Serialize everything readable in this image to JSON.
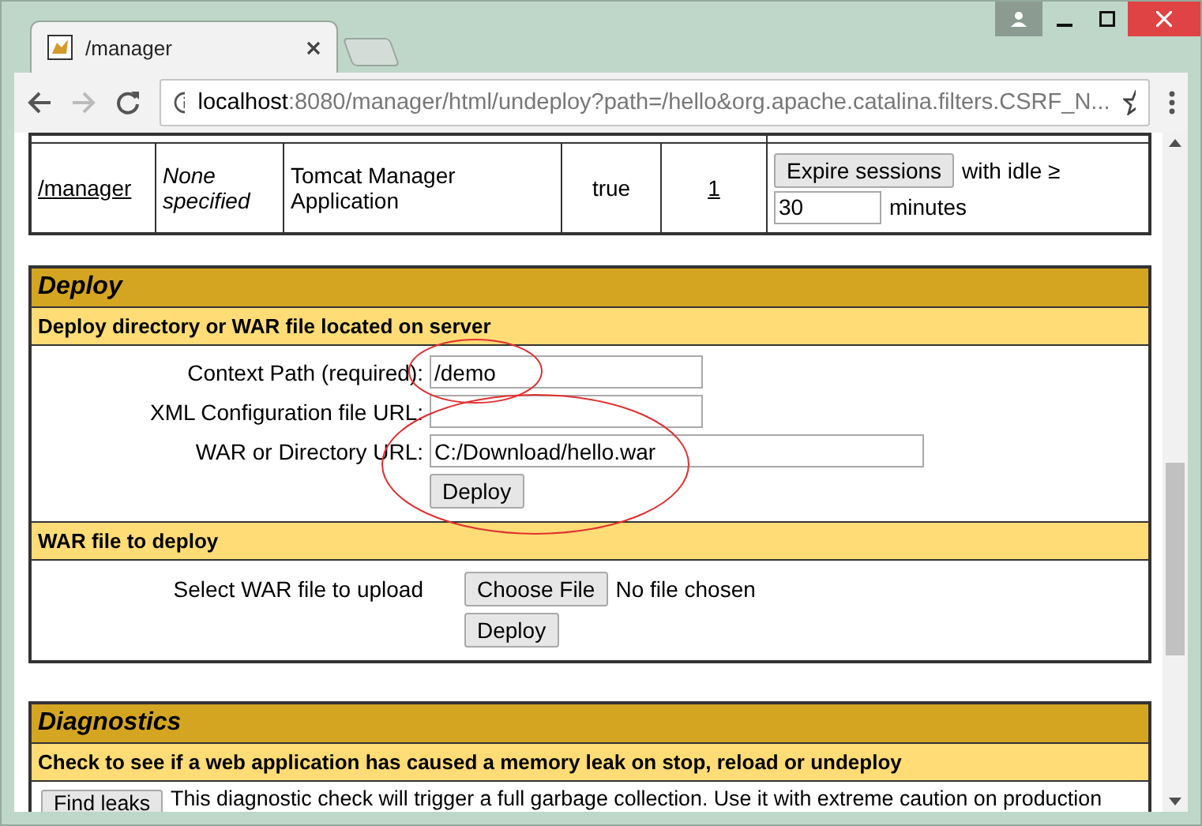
{
  "browser": {
    "tab": {
      "title": "/manager"
    },
    "address": {
      "host": "localhost",
      "rest": ":8080/manager/html/undeploy?path=/hello&org.apache.catalina.filters.CSRF_N..."
    }
  },
  "applications_row": {
    "path": "/manager",
    "version": "None specified",
    "display_name": "Tomcat Manager Application",
    "running": "true",
    "sessions": "1",
    "expire_button": "Expire sessions",
    "idle_label": "with idle ≥",
    "idle_value": "30",
    "minutes_label": "minutes"
  },
  "deploy": {
    "title": "Deploy",
    "server_section": {
      "heading": "Deploy directory or WAR file located on server",
      "fields": [
        {
          "label": "Context Path (required):",
          "value": "/demo"
        },
        {
          "label": "XML Configuration file URL:"
        },
        {
          "label": "WAR or Directory URL:",
          "value": "C:/Download/hello.war"
        }
      ],
      "button": "Deploy"
    },
    "upload_section": {
      "heading": "WAR file to deploy",
      "label": "Select WAR file to upload",
      "choose_button": "Choose File",
      "file_status": "No file chosen",
      "button": "Deploy"
    }
  },
  "diagnostics": {
    "title": "Diagnostics",
    "heading": "Check to see if a web application has caused a memory leak on stop, reload or undeploy",
    "button": "Find leaks",
    "text": "This diagnostic check will trigger a full garbage collection. Use it with extreme caution on production"
  }
}
